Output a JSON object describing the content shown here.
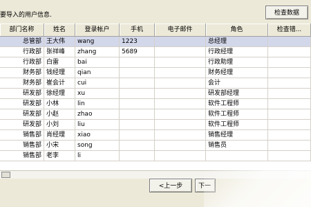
{
  "instruction": "要导入的用户信息.",
  "check_button_label": "检查数据",
  "columns": [
    "部门名称",
    "姓名",
    "登录帐户",
    "手机",
    "电子邮件",
    "角色",
    "检查错..."
  ],
  "rows": [
    {
      "dept": "总管部",
      "name": "王大伟",
      "account": "wang",
      "phone": "1223",
      "email": "",
      "role": "总经理",
      "check": ""
    },
    {
      "dept": "行政部",
      "name": "张祥峰",
      "account": "zhang",
      "phone": "5689",
      "email": "",
      "role": "行政经理",
      "check": ""
    },
    {
      "dept": "行政部",
      "name": "白雷",
      "account": "bai",
      "phone": "",
      "email": "",
      "role": "行政助理",
      "check": ""
    },
    {
      "dept": "财务部",
      "name": "钱经理",
      "account": "qian",
      "phone": "",
      "email": "",
      "role": "财务经理",
      "check": ""
    },
    {
      "dept": "财务部",
      "name": "崔会计",
      "account": "cui",
      "phone": "",
      "email": "",
      "role": "会计",
      "check": ""
    },
    {
      "dept": "研发部",
      "name": "徐经理",
      "account": "xu",
      "phone": "",
      "email": "",
      "role": "研发部经理",
      "check": ""
    },
    {
      "dept": "研发部",
      "name": "小林",
      "account": "lin",
      "phone": "",
      "email": "",
      "role": "软件工程师",
      "check": ""
    },
    {
      "dept": "研发部",
      "name": "小赵",
      "account": "zhao",
      "phone": "",
      "email": "",
      "role": "软件工程师",
      "check": ""
    },
    {
      "dept": "研发部",
      "name": "小刘",
      "account": "liu",
      "phone": "",
      "email": "",
      "role": "软件工程师",
      "check": ""
    },
    {
      "dept": "销售部",
      "name": "肖经理",
      "account": "xiao",
      "phone": "",
      "email": "",
      "role": "销售经理",
      "check": ""
    },
    {
      "dept": "销售部",
      "name": "小宋",
      "account": "song",
      "phone": "",
      "email": "",
      "role": "销售员",
      "check": ""
    },
    {
      "dept": "销售部",
      "name": "老李",
      "account": "li",
      "phone": "",
      "email": "",
      "role": "",
      "check": ""
    }
  ],
  "prev_button_label": "<上一步",
  "next_button_label": "下一",
  "selection_color": "#d3d7ea"
}
